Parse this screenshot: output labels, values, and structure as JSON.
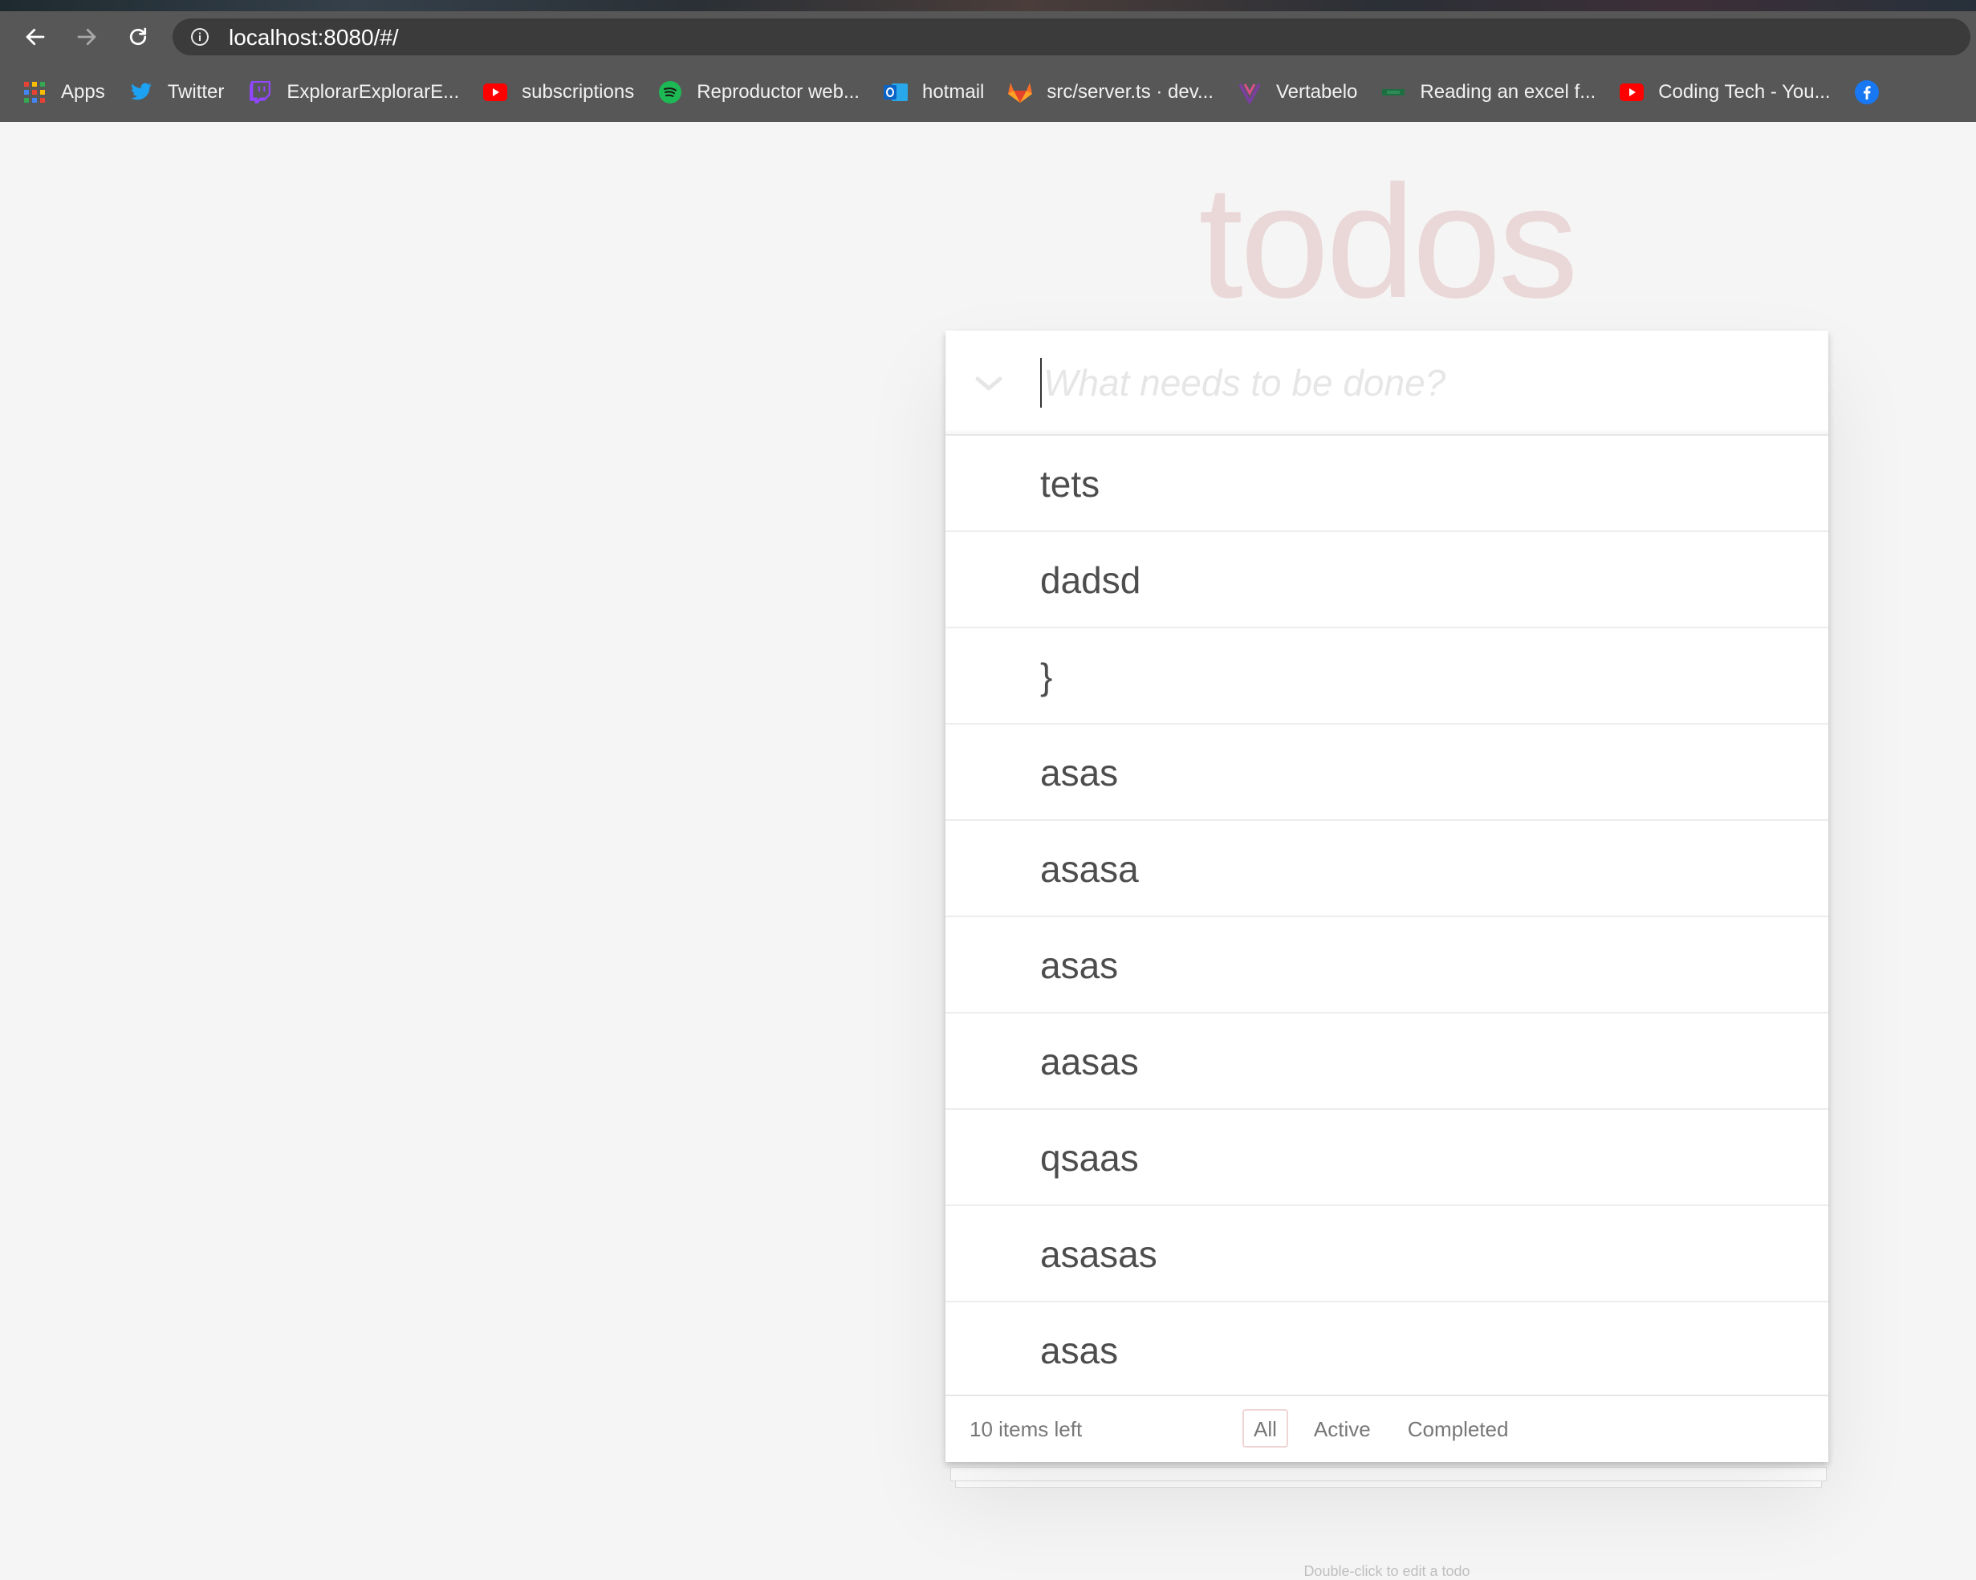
{
  "browser": {
    "url": "localhost:8080/#/",
    "bookmarks": [
      {
        "label": "Apps",
        "icon": "apps-grid-icon",
        "color": "#e94235"
      },
      {
        "label": "Twitter",
        "icon": "twitter-icon",
        "color": "#1da1f2"
      },
      {
        "label": "ExplorarExplorarE...",
        "icon": "twitch-icon",
        "color": "#9146ff"
      },
      {
        "label": "subscriptions",
        "icon": "youtube-icon",
        "color": "#ff0000"
      },
      {
        "label": "Reproductor web...",
        "icon": "spotify-icon",
        "color": "#1db954"
      },
      {
        "label": "hotmail",
        "icon": "outlook-icon",
        "color": "#0a64c8"
      },
      {
        "label": "src/server.ts · dev...",
        "icon": "gitlab-icon",
        "color": "#fc6d26"
      },
      {
        "label": "Vertabelo",
        "icon": "vertabelo-icon",
        "color": "#7b3fa0"
      },
      {
        "label": "Reading an excel f...",
        "icon": "excel-icon",
        "color": "#1d6f42"
      },
      {
        "label": "Coding Tech - You...",
        "icon": "youtube-icon",
        "color": "#ff0000"
      }
    ]
  },
  "app": {
    "title": "todos",
    "new_todo_placeholder": "What needs to be done?",
    "todos": [
      "tets",
      "dadsd",
      "}",
      "asas",
      "asasa",
      "asas",
      "aasas",
      "qsaas",
      "asasas",
      "asas"
    ],
    "items_left": "10 items left",
    "filters": [
      {
        "label": "All",
        "selected": true
      },
      {
        "label": "Active",
        "selected": false
      },
      {
        "label": "Completed",
        "selected": false
      }
    ],
    "footer_info": "Double-click to edit a todo"
  }
}
